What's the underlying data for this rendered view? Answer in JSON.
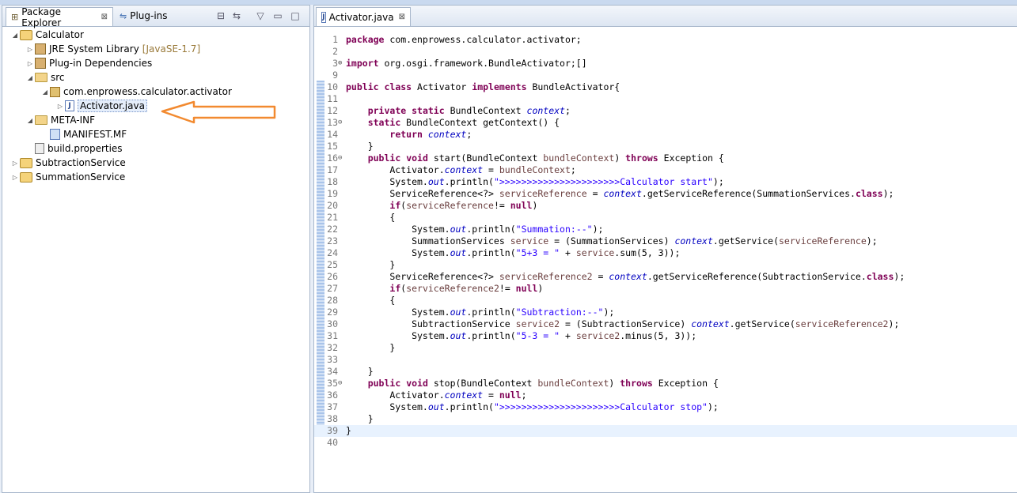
{
  "explorer": {
    "tabs": [
      {
        "label": "Package Explorer",
        "close": "⊠"
      },
      {
        "label": "Plug-ins"
      }
    ],
    "tree": [
      {
        "label": "Calculator",
        "indent": 0,
        "arrow": "◢",
        "icon": "project-icon"
      },
      {
        "label": "JRE System Library",
        "decoration": "[JavaSE-1.7]",
        "indent": 1,
        "arrow": "▷",
        "icon": "library-icon"
      },
      {
        "label": "Plug-in Dependencies",
        "indent": 1,
        "arrow": "▷",
        "icon": "library-icon"
      },
      {
        "label": "src",
        "indent": 1,
        "arrow": "◢",
        "icon": "folder-icon"
      },
      {
        "label": "com.enprowess.calculator.activator",
        "indent": 2,
        "arrow": "◢",
        "icon": "package-icon"
      },
      {
        "label": "Activator.java",
        "indent": 3,
        "arrow": "▷",
        "icon": "java-file-icon",
        "selected": true
      },
      {
        "label": "META-INF",
        "indent": 1,
        "arrow": "◢",
        "icon": "folder-icon"
      },
      {
        "label": "MANIFEST.MF",
        "indent": 2,
        "arrow": "",
        "icon": "manifest-icon"
      },
      {
        "label": "build.properties",
        "indent": 1,
        "arrow": "",
        "icon": "properties-icon"
      },
      {
        "label": "SubtractionService",
        "indent": 0,
        "arrow": "▷",
        "icon": "project-icon"
      },
      {
        "label": "SummationService",
        "indent": 0,
        "arrow": "▷",
        "icon": "project-icon"
      }
    ],
    "accent_arrow_color": "#f28a30"
  },
  "editor": {
    "tab": {
      "label": "Activator.java",
      "close": "⊠"
    },
    "current_line": 39,
    "lines": [
      {
        "n": "1",
        "t": "package com.enprowess.calculator.activator;"
      },
      {
        "n": "2",
        "t": ""
      },
      {
        "n": "3",
        "t": "import org.osgi.framework.BundleActivator;[]",
        "fold": "⊕"
      },
      {
        "n": "9",
        "t": ""
      },
      {
        "n": "10",
        "t": "public class Activator implements BundleActivator{"
      },
      {
        "n": "11",
        "t": ""
      },
      {
        "n": "12",
        "t": "    private static BundleContext context;"
      },
      {
        "n": "13",
        "t": "    static BundleContext getContext() {",
        "fold": "⊖"
      },
      {
        "n": "14",
        "t": "        return context;"
      },
      {
        "n": "15",
        "t": "    }"
      },
      {
        "n": "16",
        "t": "    public void start(BundleContext bundleContext) throws Exception {",
        "fold": "⊖"
      },
      {
        "n": "17",
        "t": "        Activator.context = bundleContext;"
      },
      {
        "n": "18",
        "t": "        System.out.println(\">>>>>>>>>>>>>>>>>>>>>>Calculator start\");"
      },
      {
        "n": "19",
        "t": "        ServiceReference<?> serviceReference = context.getServiceReference(SummationServices.class);"
      },
      {
        "n": "20",
        "t": "        if(serviceReference!= null)"
      },
      {
        "n": "21",
        "t": "        {"
      },
      {
        "n": "22",
        "t": "            System.out.println(\"Summation:--\");"
      },
      {
        "n": "23",
        "t": "            SummationServices service = (SummationServices) context.getService(serviceReference);"
      },
      {
        "n": "24",
        "t": "            System.out.println(\"5+3 = \" + service.sum(5, 3));"
      },
      {
        "n": "25",
        "t": "        }"
      },
      {
        "n": "26",
        "t": "        ServiceReference<?> serviceReference2 = context.getServiceReference(SubtractionService.class);"
      },
      {
        "n": "27",
        "t": "        if(serviceReference2!= null)"
      },
      {
        "n": "28",
        "t": "        {"
      },
      {
        "n": "29",
        "t": "            System.out.println(\"Subtraction:--\");"
      },
      {
        "n": "30",
        "t": "            SubtractionService service2 = (SubtractionService) context.getService(serviceReference2);"
      },
      {
        "n": "31",
        "t": "            System.out.println(\"5-3 = \" + service2.minus(5, 3));"
      },
      {
        "n": "32",
        "t": "        }"
      },
      {
        "n": "33",
        "t": ""
      },
      {
        "n": "34",
        "t": "    }"
      },
      {
        "n": "35",
        "t": "    public void stop(BundleContext bundleContext) throws Exception {",
        "fold": "⊖"
      },
      {
        "n": "36",
        "t": "        Activator.context = null;"
      },
      {
        "n": "37",
        "t": "        System.out.println(\">>>>>>>>>>>>>>>>>>>>>>Calculator stop\");"
      },
      {
        "n": "38",
        "t": "    }"
      },
      {
        "n": "39",
        "t": "}"
      },
      {
        "n": "40",
        "t": ""
      }
    ]
  }
}
